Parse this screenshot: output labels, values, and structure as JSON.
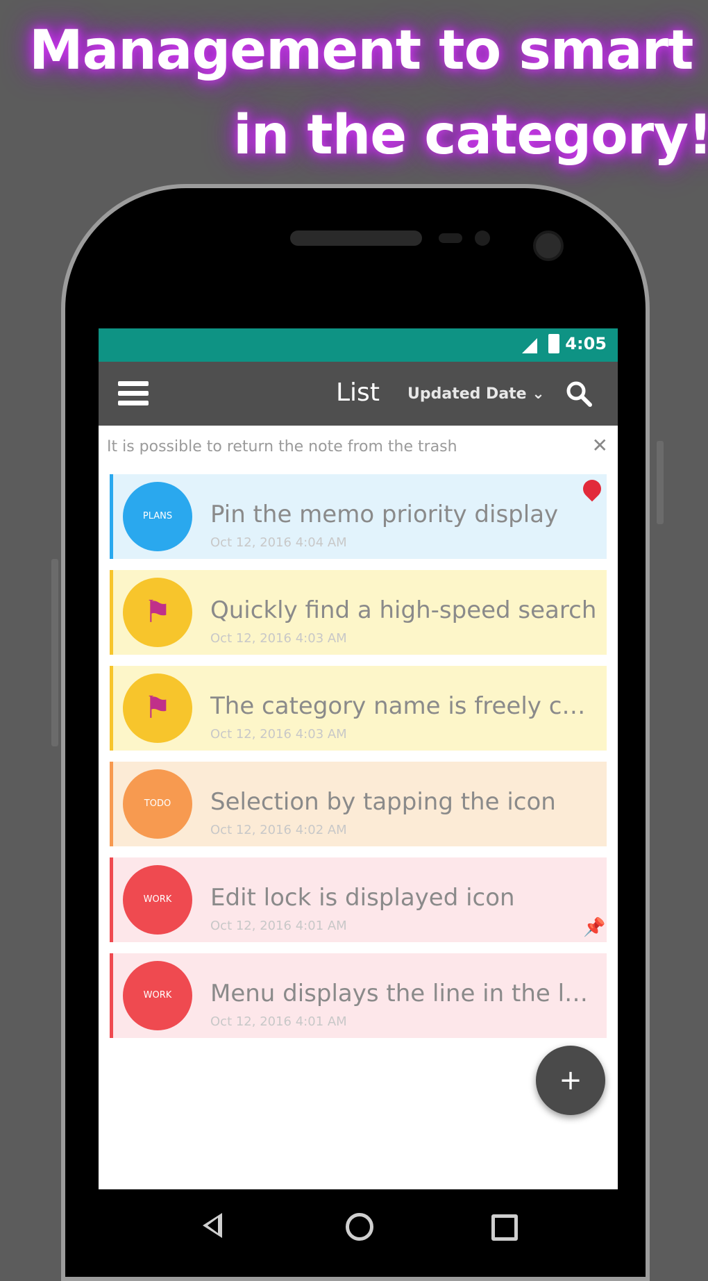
{
  "headline": {
    "line1": "Management to smart",
    "line2": "in the category!"
  },
  "statusbar": {
    "time": "4:05"
  },
  "toolbar": {
    "title": "List",
    "sort_label": "Updated Date"
  },
  "notice": {
    "text": "It is possible to return the note from the trash",
    "close": "✕"
  },
  "notes": [
    {
      "avatar_label": "PLANS",
      "title": "Pin the memo priority display",
      "date": "Oct 12, 2016 4:04 AM"
    },
    {
      "avatar_label": "",
      "title": "Quickly find a high-speed search",
      "date": "Oct 12, 2016 4:03 AM"
    },
    {
      "avatar_label": "",
      "title": "The category name is freely chan...",
      "date": "Oct 12, 2016 4:03 AM"
    },
    {
      "avatar_label": "TODO",
      "title": "Selection by tapping the icon",
      "date": "Oct 12, 2016 4:02 AM"
    },
    {
      "avatar_label": "WORK",
      "title": "Edit lock is displayed icon",
      "date": "Oct 12, 2016 4:01 AM"
    },
    {
      "avatar_label": "WORK",
      "title": "Menu displays the line in the lon...",
      "date": "Oct 12, 2016 4:01 AM"
    }
  ],
  "fab": {
    "label": "+"
  },
  "colors": {
    "accent": "#0e9384",
    "toolbar": "#4f4f4f",
    "blue": "#2aa8ee",
    "yellow": "#f7c52c",
    "orange": "#f79a50",
    "red": "#ef4a50"
  }
}
